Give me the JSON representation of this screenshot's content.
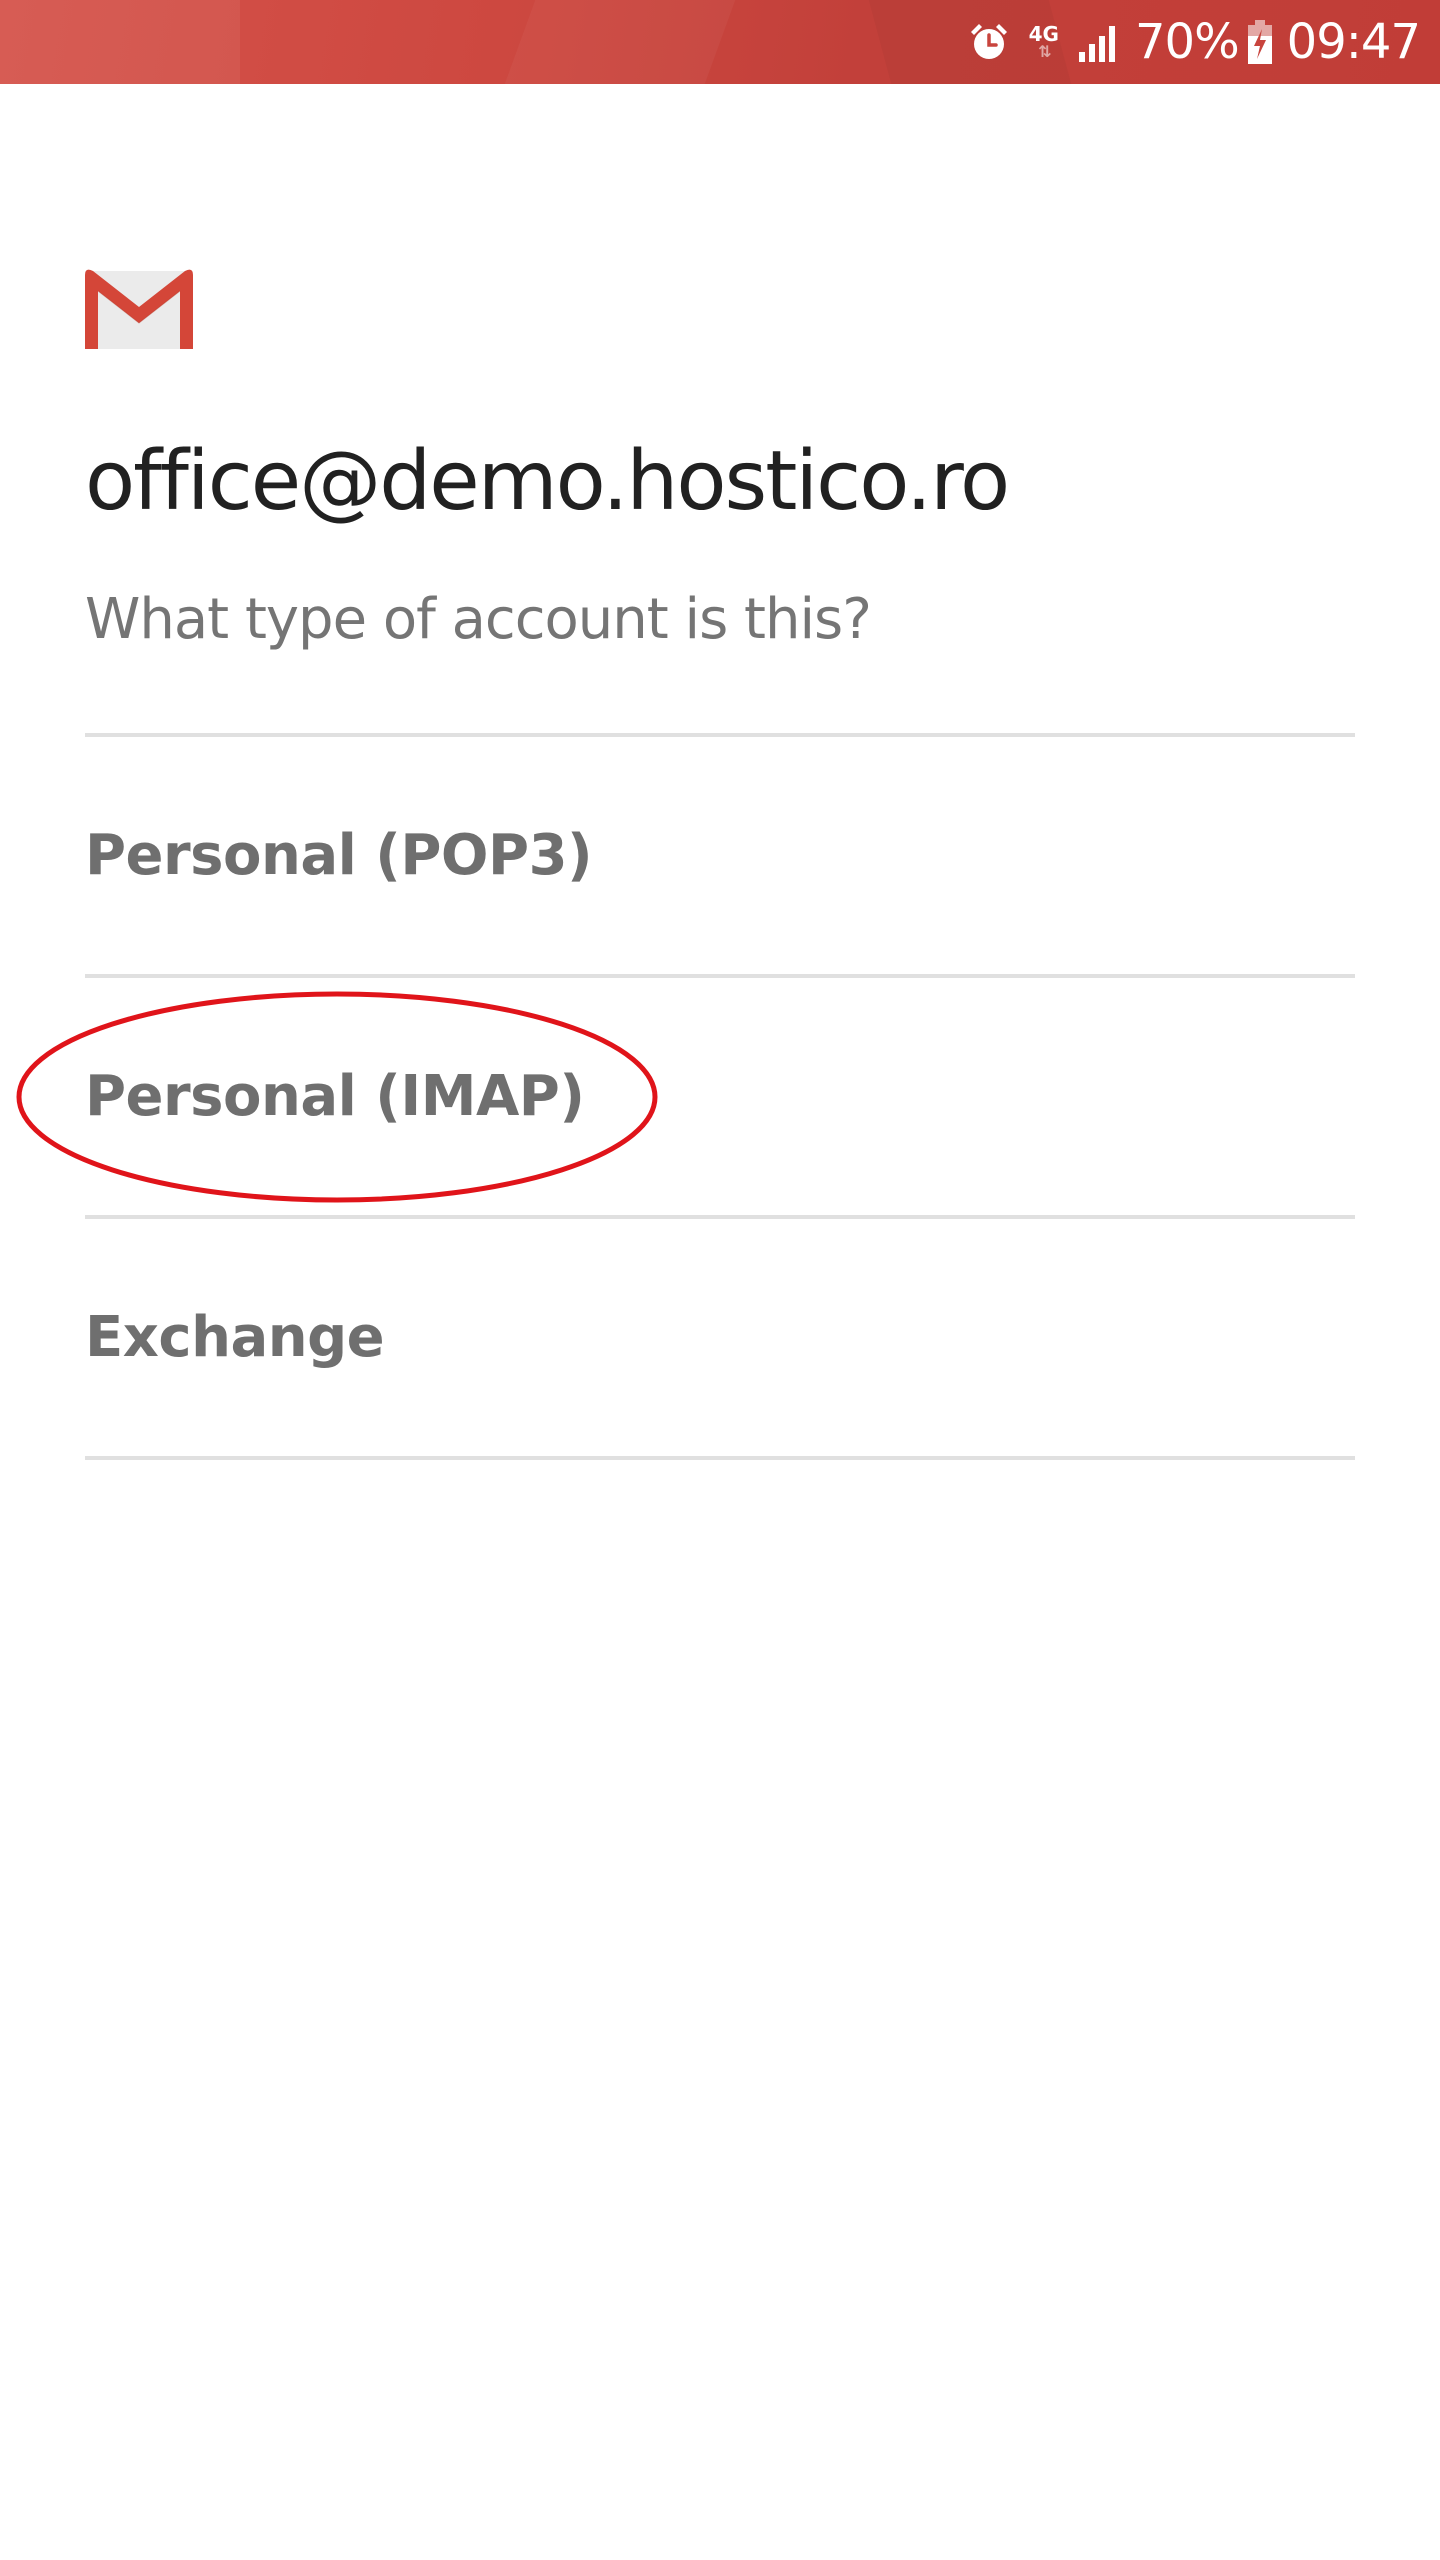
{
  "status_bar": {
    "network_type": "4G",
    "battery_percent": "70%",
    "time": "09:47",
    "icons": [
      "alarm-icon",
      "network-4g-icon",
      "signal-icon",
      "battery-charging-icon"
    ],
    "background_color": "#c8443d"
  },
  "app": {
    "logo_icon": "gmail-logo-icon",
    "account_email": "office@demo.hostico.ro",
    "prompt": "What type of account is this?"
  },
  "options": [
    {
      "label": "Personal (POP3)"
    },
    {
      "label": "Personal (IMAP)",
      "highlighted": true
    },
    {
      "label": "Exchange"
    }
  ],
  "colors": {
    "title": "#212121",
    "secondary_text": "#757575",
    "option_text": "#6f6f6f",
    "divider": "#e0e0e0",
    "highlight": "#e0141a"
  }
}
